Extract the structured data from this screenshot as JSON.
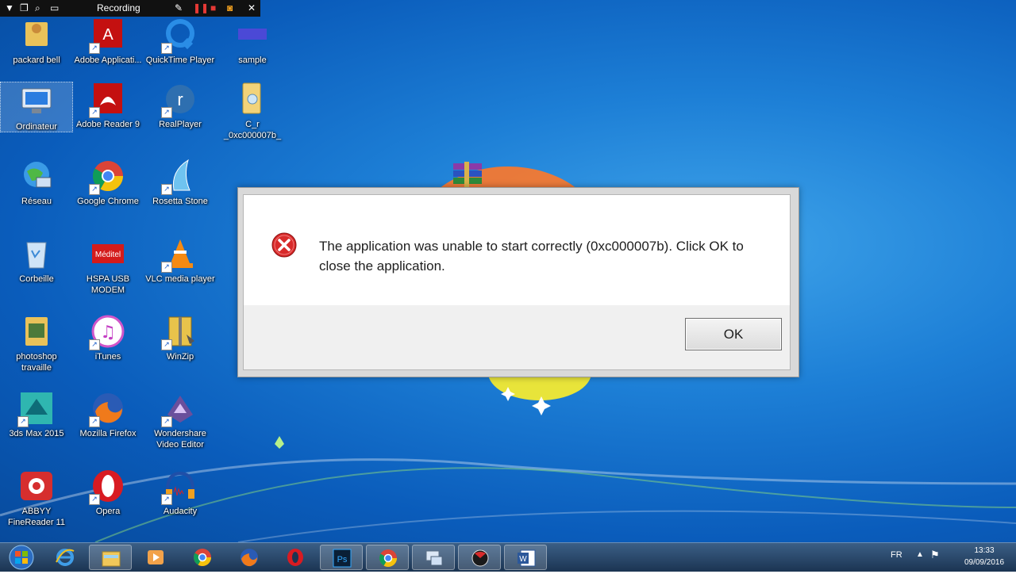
{
  "recording_bar": {
    "label": "Recording"
  },
  "desktop_icons": [
    {
      "label": "packard bell"
    },
    {
      "label": "Adobe Applicati..."
    },
    {
      "label": "QuickTime Player"
    },
    {
      "label": "sample"
    },
    {
      "label": "Ordinateur"
    },
    {
      "label": "Adobe Reader 9"
    },
    {
      "label": "RealPlayer"
    },
    {
      "label": "C_r _0xc000007b_"
    },
    {
      "label": "Réseau"
    },
    {
      "label": "Google Chrome"
    },
    {
      "label": "Rosetta Stone"
    },
    {
      "label": "Corbeille"
    },
    {
      "label": "HSPA USB MODEM"
    },
    {
      "label": "VLC media player"
    },
    {
      "label": "photoshop travaille"
    },
    {
      "label": "iTunes"
    },
    {
      "label": "WinZip"
    },
    {
      "label": "3ds Max 2015"
    },
    {
      "label": "Mozilla Firefox"
    },
    {
      "label": "Wondershare Video Editor"
    },
    {
      "label": "ABBYY FineReader 11"
    },
    {
      "label": "Opera"
    },
    {
      "label": "Audacity"
    }
  ],
  "dialog": {
    "message": "The application was unable to start correctly (0xc000007b). Click OK to close the application.",
    "ok_label": "OK"
  },
  "taskbar": {
    "language": "FR",
    "time": "13:33",
    "date": "09/09/2016"
  }
}
